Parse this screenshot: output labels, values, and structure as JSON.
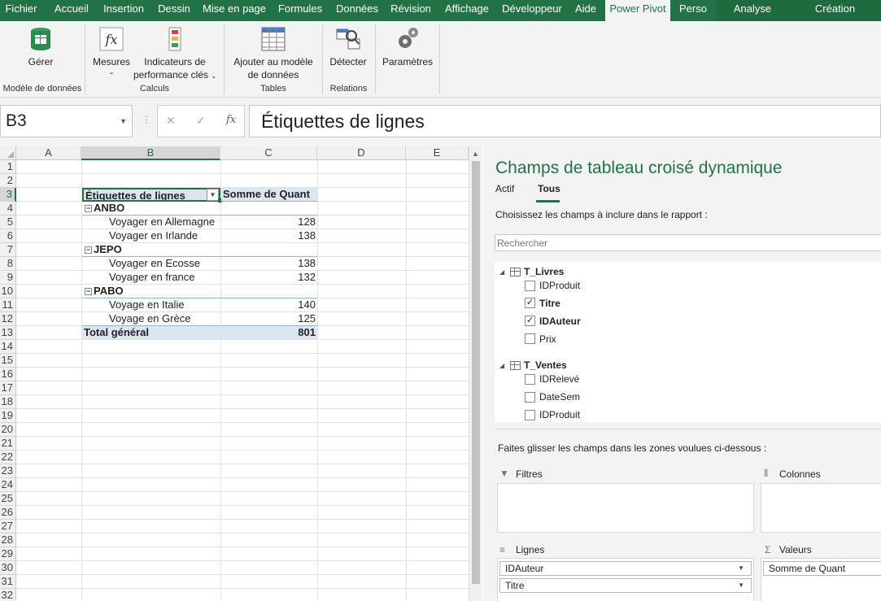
{
  "ribbon_tabs": [
    "Fichier",
    "Accueil",
    "Insertion",
    "Dessin",
    "Mise en page",
    "Formules",
    "Données",
    "Révision",
    "Affichage",
    "Développeur",
    "Aide",
    "Power Pivot",
    "Perso",
    "Analyse",
    "Création"
  ],
  "ribbon": {
    "manage": "Gérer",
    "measures": "Mesures",
    "kpi_line1": "Indicateurs de",
    "kpi_line2": "performance clés",
    "add_model_line1": "Ajouter au modèle",
    "add_model_line2": "de données",
    "detect": "Détecter",
    "settings": "Paramètres",
    "groups": [
      "Modèle de données",
      "Calculs",
      "Tables",
      "Relations"
    ]
  },
  "formula_bar": {
    "name_box": "B3",
    "cancel": "✕",
    "enter": "✓",
    "fx": "fx",
    "content": "Étiquettes de lignes"
  },
  "columns": [
    "A",
    "B",
    "C",
    "D",
    "E"
  ],
  "rows": [
    "1",
    "2",
    "3",
    "4",
    "5",
    "6",
    "7",
    "8",
    "9",
    "10",
    "11",
    "12",
    "13",
    "14",
    "15",
    "16",
    "17",
    "18",
    "19",
    "20",
    "21",
    "22",
    "23",
    "24",
    "25",
    "26",
    "27",
    "28",
    "29",
    "30",
    "31",
    "32"
  ],
  "pivot": {
    "header_rows": "Étiquettes de lignes",
    "header_values": "Somme de Quant",
    "groups": [
      {
        "name": "ANBO",
        "items": [
          {
            "label": "Voyager en Allemagne",
            "value": "128"
          },
          {
            "label": "Voyager en Irlande",
            "value": "138"
          }
        ]
      },
      {
        "name": "JEPO",
        "items": [
          {
            "label": "Voyager en Ecosse",
            "value": "138"
          },
          {
            "label": "Voyager en france",
            "value": "132"
          }
        ]
      },
      {
        "name": "PABO",
        "items": [
          {
            "label": "Voyage en Italie",
            "value": "140"
          },
          {
            "label": "Voyage en Grèce",
            "value": "125"
          }
        ]
      }
    ],
    "total_label": "Total général",
    "total_value": "801"
  },
  "pane": {
    "title": "Champs de tableau croisé dynamique",
    "tab_active": "Actif",
    "tab_all": "Tous",
    "instruction": "Choisissez les champs à inclure dans le rapport :",
    "search_placeholder": "Rechercher",
    "tables": [
      {
        "name": "T_Livres",
        "fields": [
          {
            "name": "IDProduit",
            "checked": false
          },
          {
            "name": "Titre",
            "checked": true
          },
          {
            "name": "IDAuteur",
            "checked": true
          },
          {
            "name": "Prix",
            "checked": false
          }
        ]
      },
      {
        "name": "T_Ventes",
        "fields": [
          {
            "name": "IDRelevé",
            "checked": false
          },
          {
            "name": "DateSem",
            "checked": false
          },
          {
            "name": "IDProduit",
            "checked": false
          }
        ]
      }
    ],
    "drag_text": "Faites glisser les champs dans les zones voulues ci-dessous :",
    "zones": {
      "filters": "Filtres",
      "columns": "Colonnes",
      "rows": "Lignes",
      "values": "Valeurs",
      "rows_fields": [
        "IDAuteur",
        "Titre"
      ],
      "values_fields": [
        "Somme de Quant"
      ]
    }
  }
}
